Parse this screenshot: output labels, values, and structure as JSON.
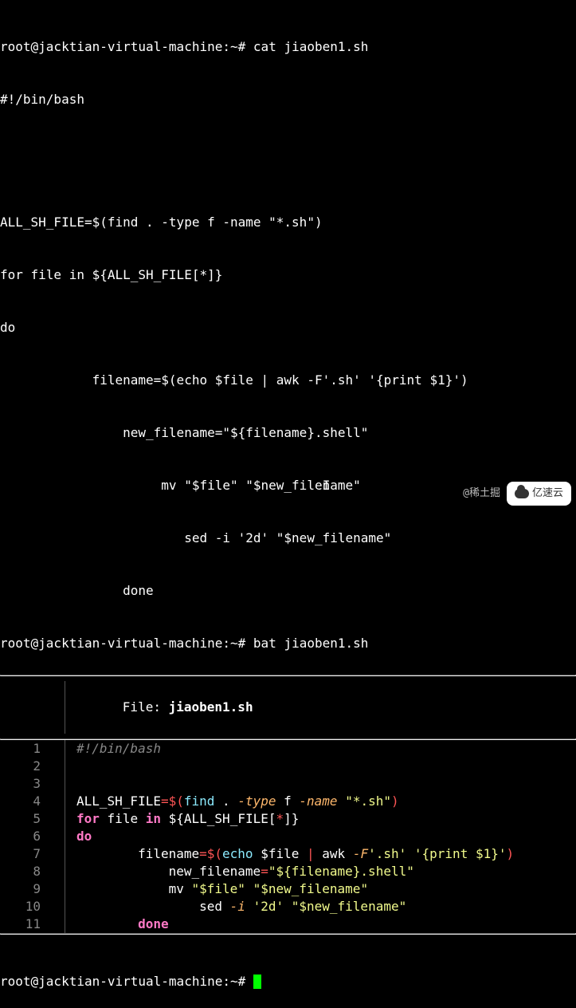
{
  "prompt1": {
    "user": "root@jacktian-virtual-machine",
    "path": "~",
    "symbol": "#",
    "command": "cat jiaoben1.sh"
  },
  "cat_output": {
    "l1": "#!/bin/bash",
    "l2": "ALL_SH_FILE=$(find . -type f -name \"*.sh\")",
    "l3": "for file in ${ALL_SH_FILE[*]}",
    "l4": "do",
    "l5": "            filename=$(echo $file | awk -F'.sh' '{print $1}')",
    "l6": "                new_filename=\"${filename}.shell\"",
    "l7": "                     mv \"$file\" \"$new_filename\"",
    "l8": "                        sed -i '2d' \"$new_filename\"",
    "l9": "                done"
  },
  "prompt2": {
    "user": "root@jacktian-virtual-machine",
    "path": "~",
    "symbol": "#",
    "command": "bat jiaoben1.sh"
  },
  "bat": {
    "file_label": "File:",
    "filename": "jiaoben1.sh",
    "rows": [
      {
        "n": "1"
      },
      {
        "n": "2"
      },
      {
        "n": "3"
      },
      {
        "n": "4"
      },
      {
        "n": "5"
      },
      {
        "n": "6"
      },
      {
        "n": "7"
      },
      {
        "n": "8"
      },
      {
        "n": "9"
      },
      {
        "n": "10"
      },
      {
        "n": "11"
      }
    ],
    "code": {
      "shebang": "#!/bin/bash",
      "r4": {
        "var": "ALL_SH_FILE",
        "eq": "=",
        "dol": "$(",
        "cmd": "find",
        "args": " . ",
        "flag1": "-type",
        "a1": " f ",
        "flag2": "-name",
        "sp": " ",
        "str": "\"*.sh\"",
        "close": ")"
      },
      "r5": {
        "kw1": "for",
        "sp1": " ",
        "var": "file",
        "sp2": " ",
        "kw2": "in",
        "sp3": " ",
        "rest": "${ALL_SH_FILE[",
        "ast": "*",
        "rest2": "]}"
      },
      "r6": {
        "kw": "do"
      },
      "r7": {
        "pad": "        ",
        "var": "filename",
        "eq": "=",
        "dol": "$(",
        "cmd": "echo",
        "sp": " $file ",
        "pipe": "|",
        "sp2": " ",
        "cmd2": "awk ",
        "flag": "-F",
        "str": "'.sh'",
        "sp3": " ",
        "str2": "'{print $1}'",
        "close": ")"
      },
      "r8": {
        "pad": "            ",
        "var": "new_filename",
        "eq": "=",
        "str": "\"${filename}.shell\""
      },
      "r9": {
        "pad": "            ",
        "cmd": "mv ",
        "str1": "\"$file\"",
        "sp": " ",
        "str2": "\"$new_filename\""
      },
      "r10": {
        "pad": "                ",
        "cmd": "sed ",
        "flag": "-i",
        "sp": " ",
        "str1": "'2d'",
        "sp2": " ",
        "str2": "\"$new_filename\""
      },
      "r11": {
        "pad": "        ",
        "kw": "done"
      }
    }
  },
  "prompt3": {
    "user": "root@jacktian-virtual-machine",
    "path": "~",
    "symbol": "#"
  },
  "watermark": {
    "text1": "@稀土掘",
    "text2": "亿速云"
  },
  "text_cursor": "I"
}
